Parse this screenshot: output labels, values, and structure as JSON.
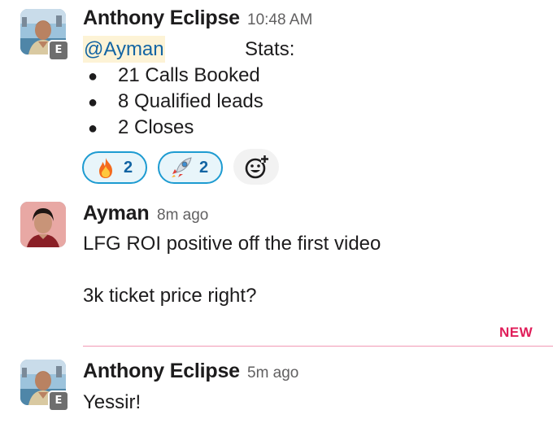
{
  "messages": [
    {
      "author": "Anthony Eclipse",
      "time": "10:48 AM",
      "external_badge": "E",
      "mention": "@Ayman",
      "heading": "Stats:",
      "bullets": [
        "21 Calls Booked",
        "8 Qualified leads",
        "2 Closes"
      ],
      "reactions": [
        {
          "emoji": "fire-emoji",
          "count": "2"
        },
        {
          "emoji": "rocket-emoji",
          "count": "2"
        }
      ]
    },
    {
      "author": "Ayman",
      "time": "8m ago",
      "lines": [
        "LFG ROI positive off the first video",
        "3k ticket price right?"
      ]
    },
    {
      "author": "Anthony Eclipse",
      "time": "5m ago",
      "external_badge": "E",
      "text": "Yessir!"
    }
  ],
  "new_divider": {
    "label": "NEW",
    "color": "#e01e5a"
  },
  "colors": {
    "mention_bg": "#fdf3d6",
    "link": "#1264a3",
    "reaction_border": "#1d9bd1",
    "reaction_bg": "#e8f5fa"
  },
  "icons": {
    "add_reaction": "add-reaction-smiley-icon"
  }
}
